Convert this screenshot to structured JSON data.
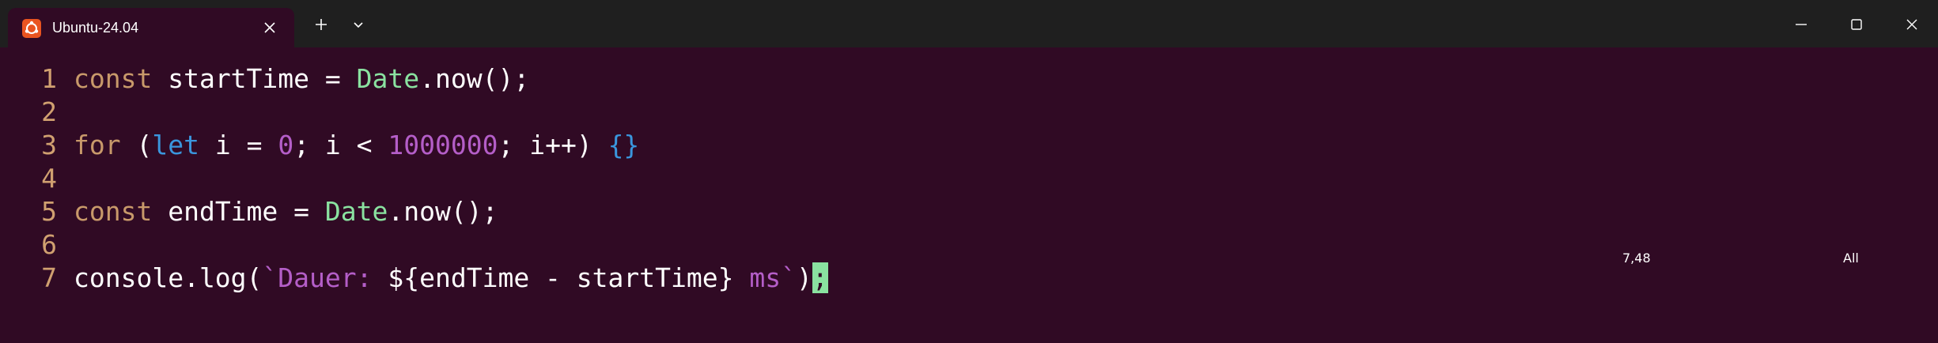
{
  "window": {
    "tab_title": "Ubuntu-24.04",
    "tab_icon": "ubuntu-icon",
    "close_tab_icon": "close-icon",
    "new_tab_glyph": "+",
    "dropdown_icon": "chevron-down-icon",
    "minimize_icon": "minimize-icon",
    "maximize_icon": "maximize-icon",
    "close_icon": "close-icon",
    "accent_color": "#e95420",
    "background_color": "#300a24"
  },
  "editor": {
    "lines": [
      {
        "num": "1",
        "tokens": [
          {
            "t": "const",
            "c": "kw"
          },
          {
            "t": " startTime = ",
            "c": ""
          },
          {
            "t": "Date",
            "c": "cls"
          },
          {
            "t": ".now();",
            "c": ""
          }
        ]
      },
      {
        "num": "2",
        "tokens": []
      },
      {
        "num": "3",
        "tokens": [
          {
            "t": "for",
            "c": "kw"
          },
          {
            "t": " (",
            "c": ""
          },
          {
            "t": "let",
            "c": "kw2"
          },
          {
            "t": " i = ",
            "c": ""
          },
          {
            "t": "0",
            "c": "num"
          },
          {
            "t": "; i < ",
            "c": ""
          },
          {
            "t": "1000000",
            "c": "num"
          },
          {
            "t": "; i++) ",
            "c": ""
          },
          {
            "t": "{}",
            "c": "brace"
          }
        ]
      },
      {
        "num": "4",
        "tokens": []
      },
      {
        "num": "5",
        "tokens": [
          {
            "t": "const",
            "c": "kw"
          },
          {
            "t": " endTime = ",
            "c": ""
          },
          {
            "t": "Date",
            "c": "cls"
          },
          {
            "t": ".now();",
            "c": ""
          }
        ]
      },
      {
        "num": "6",
        "tokens": []
      },
      {
        "num": "7",
        "tokens": [
          {
            "t": "console.log(",
            "c": ""
          },
          {
            "t": "`Dauer: ",
            "c": "str"
          },
          {
            "t": "${endTime - startTime}",
            "c": ""
          },
          {
            "t": " ms`",
            "c": "str"
          },
          {
            "t": ")",
            "c": ""
          },
          {
            "t": ";",
            "c": "cursor"
          }
        ]
      }
    ],
    "status_position": "7,48",
    "status_scroll": "All"
  }
}
